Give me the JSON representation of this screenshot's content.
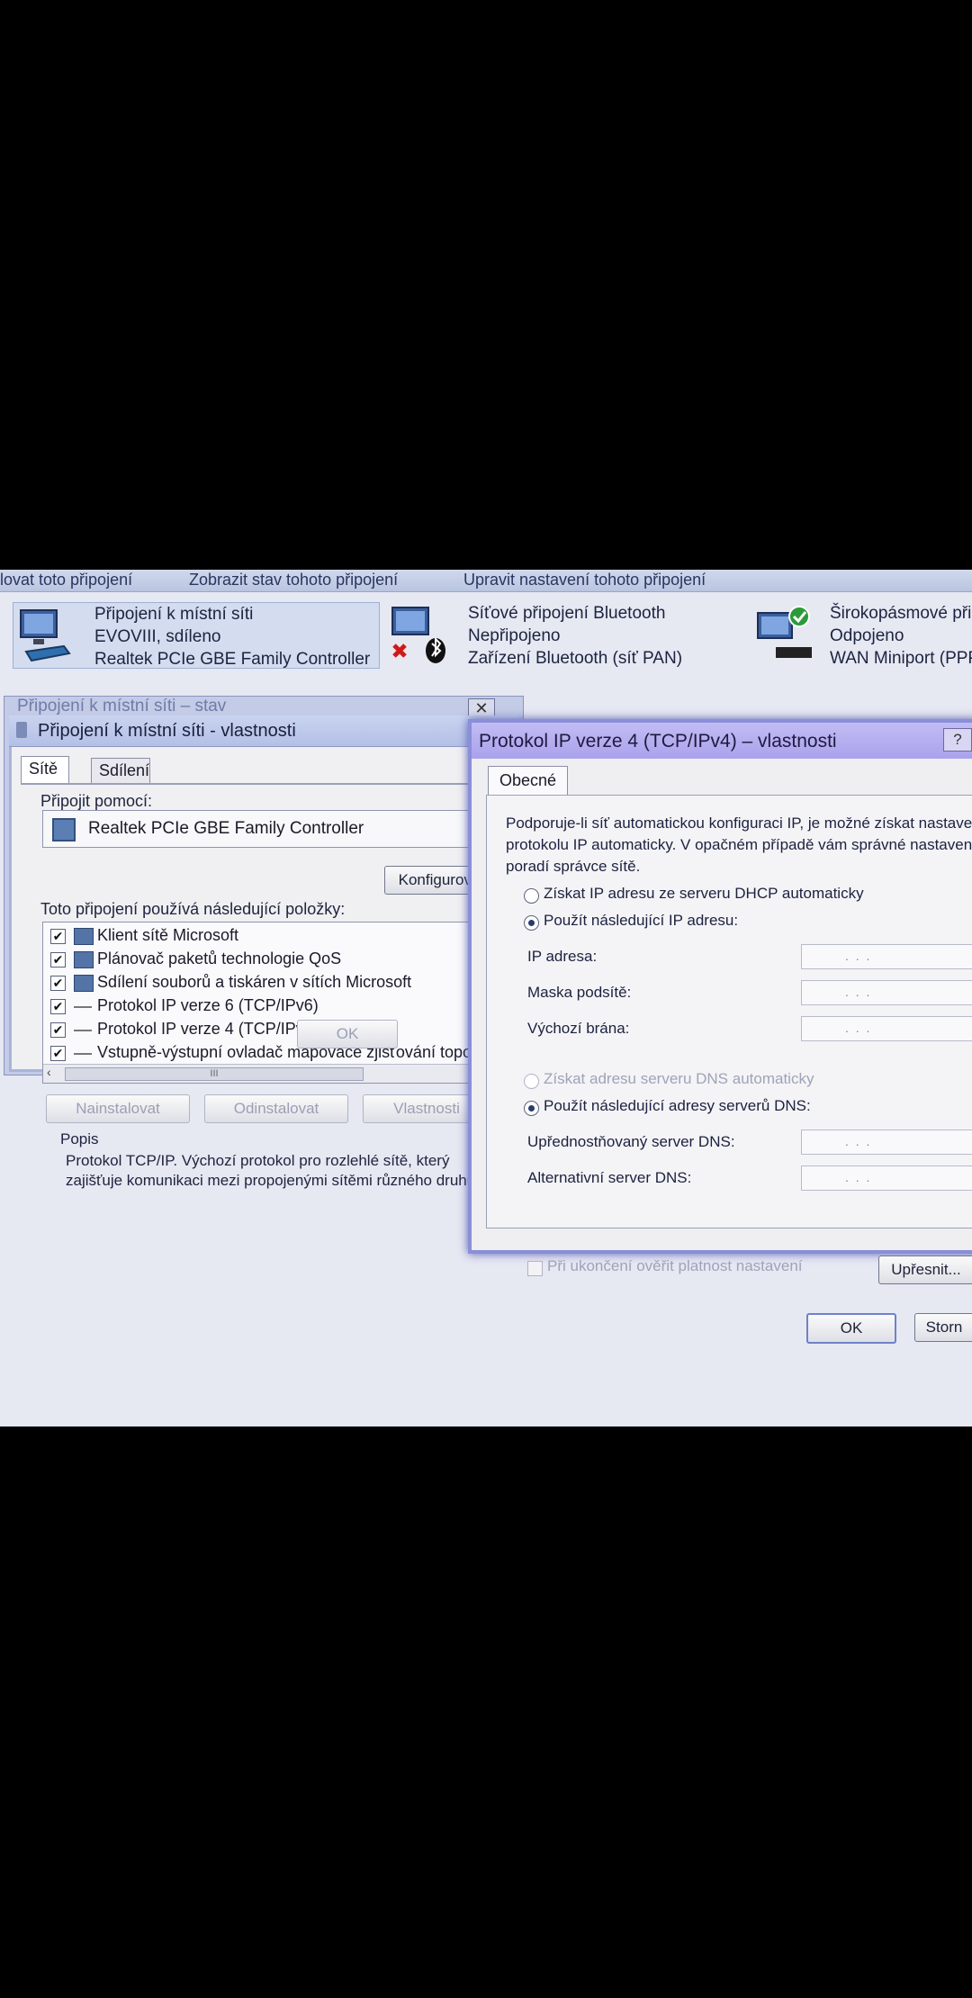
{
  "background_window": {
    "command_bar": [
      "lovat toto připojení",
      "Zobrazit stav tohoto připojení",
      "Upravit nastavení tohoto připojení"
    ],
    "connections": [
      {
        "name": "Připojení k místní síti",
        "line2": "EVOVIII, sdíleno",
        "line3": "Realtek PCIe GBE Family Controller"
      },
      {
        "name": "Síťové připojení Bluetooth",
        "line2": "Nepřipojeno",
        "line3": "Zařízení Bluetooth (síť PAN)"
      },
      {
        "name": "Širokopásmové přip",
        "line2": "Odpojeno",
        "line3": "WAN Miniport (PPP"
      }
    ],
    "status_dialog_title": "Připojení k místní síti – stav",
    "close_glyph": "✕"
  },
  "props_dialog": {
    "title": "Připojení k místní síti - vlastnosti",
    "tabs": [
      "Sítě",
      "Sdílení"
    ],
    "connect_using_label": "Připojit pomocí:",
    "adapter": "Realtek PCIe GBE Family Controller",
    "configure_button": "Konfigurova",
    "items_label": "Toto připojení používá následující položky:",
    "items": [
      {
        "label": "Klient sítě Microsoft",
        "checked": true
      },
      {
        "label": "Plánovač paketů technologie QoS",
        "checked": true
      },
      {
        "label": "Sdílení souborů a tiskáren v sítích Microsoft",
        "checked": true
      },
      {
        "label": "Protokol IP verze 6 (TCP/IPv6)",
        "checked": true
      },
      {
        "label": "Protokol IP verze 4 (TCP/IPv4)",
        "checked": true
      },
      {
        "label": "Vstupně-výstupní ovladač mapovače zjišťování topo",
        "checked": true
      }
    ],
    "scroll_thumb": "III",
    "install_button": "Nainstalovat",
    "uninstall_button": "Odinstalovat",
    "properties_button": "Vlastnosti",
    "description_label": "Popis",
    "description_text_1": "Protokol TCP/IP. Výchozí protokol pro rozlehlé sítě, který",
    "description_text_2": "zajišťuje komunikaci mezi propojenými sítěmi různého druhu",
    "ok_button": "OK",
    "check_glyph": "✔"
  },
  "ipv4_dialog": {
    "title": "Protokol IP verze 4 (TCP/IPv4) – vlastnosti",
    "help_glyph": "?",
    "tab": "Obecné",
    "info_line1": "Podporuje-li síť automatickou konfiguraci IP, je možné získat nastaven",
    "info_line2": "protokolu IP automaticky. V opačném případě vám správné nastavení",
    "info_line3": "poradí správce sítě.",
    "radio_dhcp": "Získat IP adresu ze serveru DHCP automaticky",
    "radio_static_ip": "Použít následující IP adresu:",
    "ip_address_label": "IP adresa:",
    "subnet_label": "Maska podsítě:",
    "gateway_label": "Výchozí brána:",
    "radio_dns_auto": "Získat adresu serveru DNS automaticky",
    "radio_dns_static": "Použít následující adresy serverů DNS:",
    "preferred_dns_label": "Upřednostňovaný server DNS:",
    "alternate_dns_label": "Alternativní server DNS:",
    "validate_label": "Při ukončení ověřit platnost nastavení",
    "advanced_button": "Upřesnit...",
    "ok_button": "OK",
    "cancel_button": "Storn",
    "ip_dots": ". . ."
  }
}
